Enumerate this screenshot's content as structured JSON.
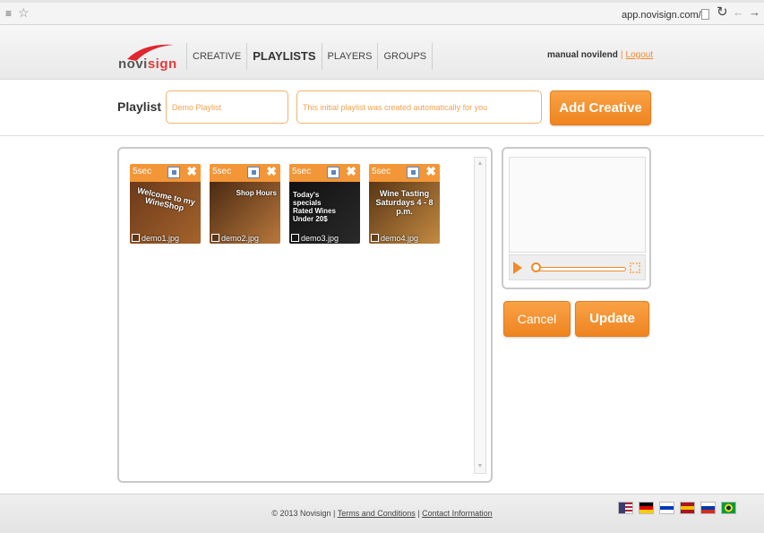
{
  "browser": {
    "url": "app.novisign.com/#"
  },
  "header": {
    "logo_text_prefix": "novi",
    "logo_text_suffix": "sign",
    "nav": [
      {
        "label": "CREATIVE"
      },
      {
        "label": "PLAYLISTS",
        "active": true
      },
      {
        "label": "PLAYERS"
      },
      {
        "label": "GROUPS"
      }
    ],
    "user_name": "manual novilend",
    "separator": "|",
    "logout_label": "Logout"
  },
  "playlist": {
    "label": "Playlist",
    "name_value": "Demo Playlist",
    "description_value": "This initial playlist was created automatically for you",
    "add_creative_label": "Add Creative"
  },
  "creatives": [
    {
      "duration": "5sec",
      "filename": "demo1.jpg",
      "caption": "Welcome to my WineShop",
      "colors": [
        "#6b3a1a",
        "#a5632b"
      ]
    },
    {
      "duration": "5sec",
      "filename": "demo2.jpg",
      "caption": "Shop Hours",
      "colors": [
        "#4a2a12",
        "#b9783c"
      ]
    },
    {
      "duration": "5sec",
      "filename": "demo3.jpg",
      "caption": "Today's specials Rated Wines Under 20$",
      "colors": [
        "#111111",
        "#2a2a2a"
      ]
    },
    {
      "duration": "5sec",
      "filename": "demo4.jpg",
      "caption": "Wine Tasting Saturdays 4 - 8 p.m.",
      "colors": [
        "#5a3614",
        "#c38a42"
      ]
    }
  ],
  "actions": {
    "cancel_label": "Cancel",
    "update_label": "Update"
  },
  "footer": {
    "copyright": "© 2013 Novisign",
    "sep": "|",
    "terms_label": "Terms and Conditions",
    "contact_label": "Contact Information",
    "flags": [
      {
        "name": "us-flag-icon",
        "colors": [
          "#b22234",
          "#ffffff",
          "#3c3b6e"
        ]
      },
      {
        "name": "germany-flag-icon",
        "colors": [
          "#000000",
          "#dd0000",
          "#ffce00"
        ]
      },
      {
        "name": "israel-flag-icon",
        "colors": [
          "#ffffff",
          "#0038b8",
          "#ffffff"
        ]
      },
      {
        "name": "spain-flag-icon",
        "colors": [
          "#aa151b",
          "#f1bf00",
          "#aa151b"
        ]
      },
      {
        "name": "russia-flag-icon",
        "colors": [
          "#ffffff",
          "#0039a6",
          "#d52b1e"
        ]
      },
      {
        "name": "brazil-flag-icon",
        "colors": [
          "#009c3b",
          "#ffdf00",
          "#002776"
        ]
      }
    ]
  }
}
